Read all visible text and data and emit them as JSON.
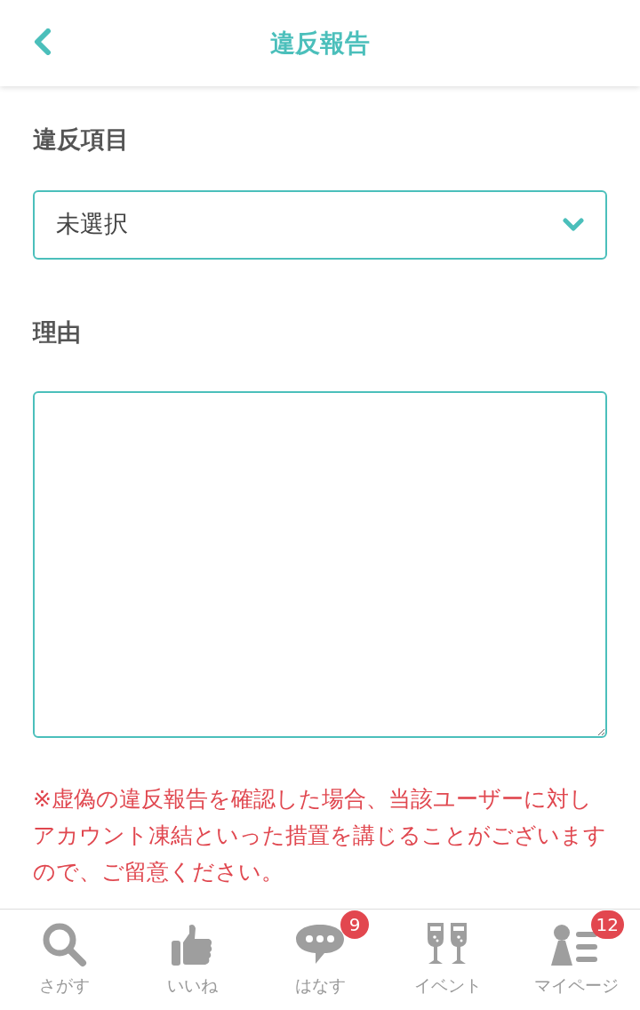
{
  "header": {
    "title": "違反報告"
  },
  "form": {
    "item_label": "違反項目",
    "select_value": "未選択",
    "reason_label": "理由",
    "warning": "※虚偽の違反報告を確認した場合、当該ユーザーに対しアカウント凍結といった措置を講じることがございますので、ご留意ください。"
  },
  "bottom_nav": [
    {
      "kind": "search",
      "label": "さがす"
    },
    {
      "kind": "like",
      "label": "いいね"
    },
    {
      "kind": "chat",
      "label": "はなす",
      "badge": "9"
    },
    {
      "kind": "event",
      "label": "イベント"
    },
    {
      "kind": "mypage",
      "label": "マイページ",
      "badge": "12"
    }
  ]
}
